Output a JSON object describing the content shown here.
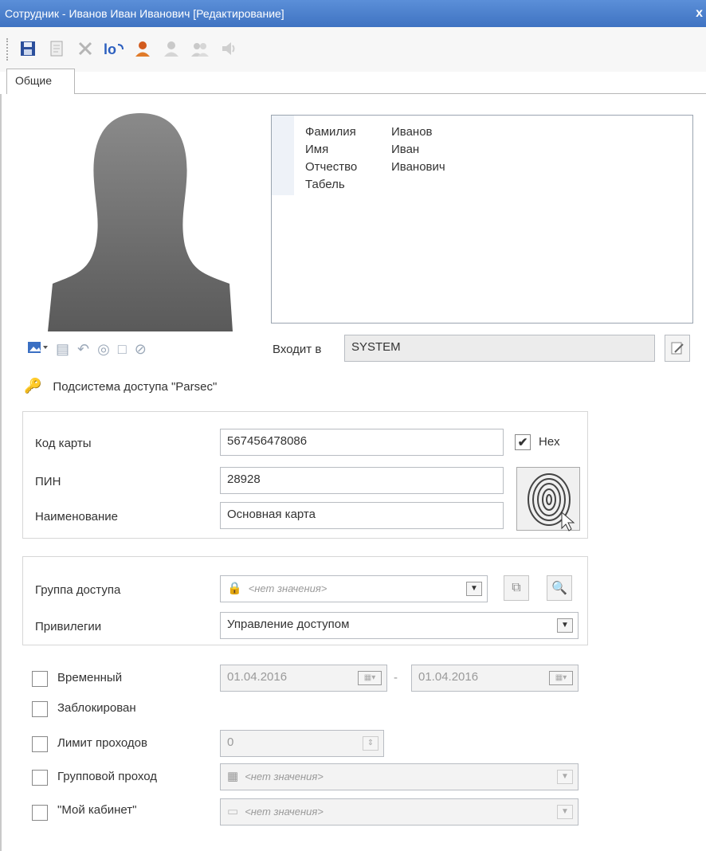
{
  "window": {
    "title": "Сотрудник - Иванов Иван Иванович [Редактирование]",
    "close": "x"
  },
  "toolbar": {
    "icons": [
      "save-icon",
      "document-icon",
      "delete-icon",
      "undo-icon",
      "user-icon",
      "user-gray-icon",
      "users-icon",
      "speaker-icon"
    ]
  },
  "tabs": [
    {
      "label": "Общие"
    }
  ],
  "person": {
    "rows": [
      {
        "label": "Фамилия",
        "value": "Иванов"
      },
      {
        "label": "Имя",
        "value": "Иван"
      },
      {
        "label": "Отчество",
        "value": "Иванович"
      },
      {
        "label": "Табель",
        "value": ""
      }
    ]
  },
  "membership": {
    "label": "Входит в",
    "value": "SYSTEM"
  },
  "subsystem": {
    "title": "Подсистема доступа \"Parsec\""
  },
  "card": {
    "code_label": "Код карты",
    "code_value": "567456478086",
    "hex_label": "Hex",
    "hex_checked": true,
    "pin_label": "ПИН",
    "pin_value": "28928",
    "name_label": "Наименование",
    "name_value": "Основная карта"
  },
  "access": {
    "group_label": "Группа доступа",
    "group_value": "<нет значения>",
    "priv_label": "Привилегии",
    "priv_value": "Управление доступом"
  },
  "options": {
    "temporary_label": "Временный",
    "date_from": "01.04.2016",
    "date_sep": "-",
    "date_to": "01.04.2016",
    "blocked_label": "Заблокирован",
    "limit_label": "Лимит проходов",
    "limit_value": "0",
    "group_pass_label": "Групповой проход",
    "group_pass_value": "<нет значения>",
    "cabinet_label": "\"Мой кабинет\"",
    "cabinet_value": "<нет значения>"
  }
}
